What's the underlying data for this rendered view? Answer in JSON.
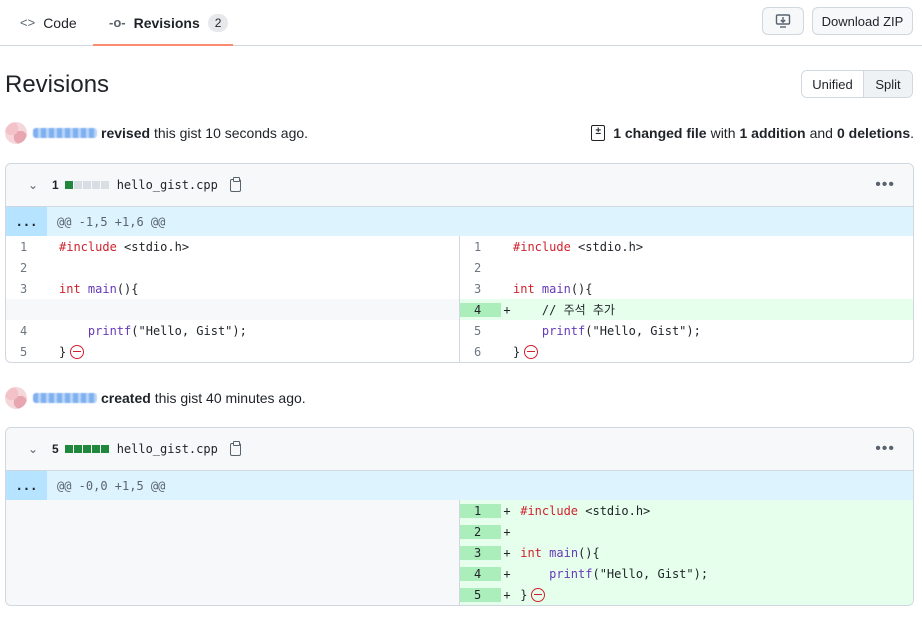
{
  "nav": {
    "tabs": [
      {
        "label": "Code",
        "icon": "code-icon"
      },
      {
        "label": "Revisions",
        "icon": "git-commit-icon",
        "count": "2"
      }
    ],
    "download_label": "Download ZIP"
  },
  "page": {
    "title": "Revisions",
    "view_modes": [
      "Unified",
      "Split"
    ],
    "selected_view": "Split"
  },
  "revisions": [
    {
      "action": "revised",
      "suffix": "this gist 10 seconds ago.",
      "summary": {
        "files": "1 changed file",
        "with": "with",
        "additions": "1 addition",
        "and": "and",
        "deletions": "0 deletions",
        "end": "."
      },
      "file": {
        "change_count": "1",
        "name": "hello_gist.cpp",
        "hunk": "@@ -1,5 +1,6 @@",
        "hunk_expand": "...",
        "left": [
          {
            "n": "1",
            "code": "#include <stdio.h>"
          },
          {
            "n": "2",
            "code": ""
          },
          {
            "n": "3",
            "code": "int main(){"
          },
          {
            "n": "",
            "code": ""
          },
          {
            "n": "4",
            "code": "    printf(\"Hello, Gist\");"
          },
          {
            "n": "5",
            "code": "}"
          }
        ],
        "right": [
          {
            "n": "1",
            "code": "#include <stdio.h>"
          },
          {
            "n": "2",
            "code": ""
          },
          {
            "n": "3",
            "code": "int main(){"
          },
          {
            "n": "4",
            "sign": "+",
            "code": "    // 주석 추가"
          },
          {
            "n": "5",
            "code": "    printf(\"Hello, Gist\");"
          },
          {
            "n": "6",
            "code": "}"
          }
        ]
      }
    },
    {
      "action": "created",
      "suffix": "this gist 40 minutes ago.",
      "file": {
        "change_count": "5",
        "name": "hello_gist.cpp",
        "hunk": "@@ -0,0 +1,5 @@",
        "hunk_expand": "...",
        "right": [
          {
            "n": "1",
            "sign": "+",
            "code": "#include <stdio.h>"
          },
          {
            "n": "2",
            "sign": "+",
            "code": ""
          },
          {
            "n": "3",
            "sign": "+",
            "code": "int main(){"
          },
          {
            "n": "4",
            "sign": "+",
            "code": "    printf(\"Hello, Gist\");"
          },
          {
            "n": "5",
            "sign": "+",
            "code": "}"
          }
        ]
      }
    }
  ],
  "colors": {
    "tab_underline": "#fd8c73",
    "addition_bg": "#e6ffec",
    "addition_gutter": "#aceebb",
    "hunk_bg": "#ddf4ff",
    "no_newline": "#cf222e"
  }
}
